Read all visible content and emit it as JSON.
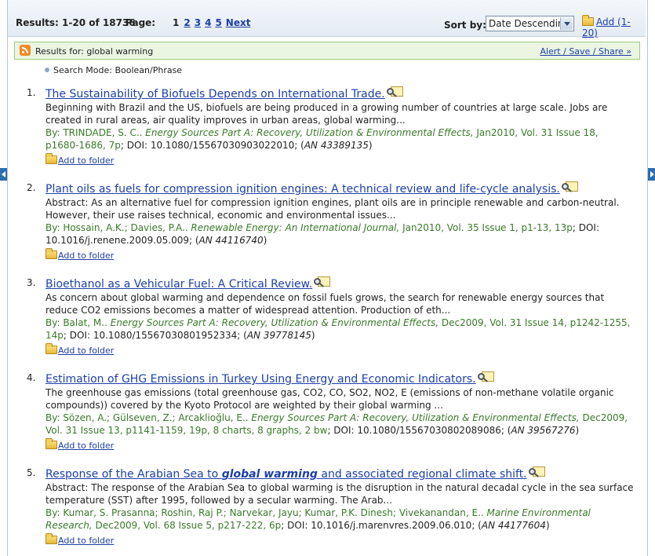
{
  "topbar": {
    "results_text": "Results: 1-20 of 18736",
    "page_label": "Page:",
    "current_page": "1",
    "pages": [
      "2",
      "3",
      "4",
      "5"
    ],
    "next_label": "Next",
    "sort_label": "Sort by:",
    "sort_value": "Date Descending",
    "add_label": "Add (1-20)"
  },
  "search_bar": {
    "results_for": "Results for:  global warming",
    "alert_link": "Alert / Save / Share »"
  },
  "search_mode": "Search Mode: Boolean/Phrase",
  "results": [
    {
      "num": "1.",
      "title": "The Sustainability of Biofuels Depends on International Trade.",
      "abstract": "Beginning with Brazil and the US, biofuels are being produced in a growing number of countries at large scale. Jobs are created in rural areas, air quality improves in urban areas, global warming...",
      "by": "By: TRINDADE, S. C.. ",
      "source": "Energy Sources Part A: Recovery, Utilization & Environmental Effects,",
      "details": " Jan2010, Vol. 31 Issue 18, p1680-1686, 7p",
      "doi": "; DOI: 10.1080/15567030903022010; (",
      "an": "AN 43389135",
      "close": ")",
      "folder": "Add to folder"
    },
    {
      "num": "2.",
      "title": "Plant oils as fuels for compression ignition engines: A technical review and life-cycle analysis.",
      "abstract": "Abstract: As an alternative fuel for compression ignition engines, plant oils are in principle renewable and carbon-neutral. However, their use raises technical, economic and environmental issues...",
      "by": "By: Hossain, A.K.; Davies, P.A.. ",
      "source": "Renewable Energy: An International Journal,",
      "details": " Jan2010, Vol. 35 Issue 1, p1-13, 13p",
      "doi": "; DOI: 10.1016/j.renene.2009.05.009; (",
      "an": "AN 44116740",
      "close": ")",
      "folder": "Add to folder"
    },
    {
      "num": "3.",
      "title": "Bioethanol as a Vehicular Fuel: A Critical Review.",
      "abstract": "As concern about global warming and dependence on fossil fuels grows, the search for renewable energy sources that reduce CO2 emissions becomes a matter of widespread attention. Production of eth...",
      "by": "By: Balat, M.. ",
      "source": "Energy Sources Part A: Recovery, Utilization & Environmental Effects,",
      "details": " Dec2009, Vol. 31 Issue 14, p1242-1255, 14p",
      "doi": "; DOI: 10.1080/15567030801952334; (",
      "an": "AN 39778145",
      "close": ")",
      "folder": "Add to folder"
    },
    {
      "num": "4.",
      "title": "Estimation of GHG Emissions in Turkey Using Energy and Economic Indicators.",
      "abstract": "The greenhouse gas emissions (total greenhouse gas, CO2, CO, SO2, NO2, E (emissions of non-methane volatile organic compounds)) covered by the Kyoto Protocol are weighted by their global warming ...",
      "by": "By: Sözen, A.; Gülseven, Z.; Arcaklioğlu, E.. ",
      "source": "Energy Sources Part A: Recovery, Utilization & Environmental Effects,",
      "details": " Dec2009, Vol. 31 Issue 13, p1141-1159, 19p, 8 charts, 8 graphs, 2 bw",
      "doi": "; DOI: 10.1080/15567030802089086; (",
      "an": "AN 39567276",
      "close": ")",
      "folder": "Add to folder"
    },
    {
      "num": "5.",
      "title_pre": "Response of the Arabian Sea to ",
      "title_em": "global warming",
      "title_post": " and associated regional climate shift.",
      "abstract": "Abstract: The response of the Arabian Sea to global warming is the disruption in the natural decadal cycle in the sea surface temperature (SST) after 1995, followed by a secular warming. The Arab...",
      "by": "By: Kumar, S. Prasanna; Roshin, Raj P.; Narvekar, Jayu; Kumar, P.K. Dinesh; Vivekanandan, E.. ",
      "source": "Marine Environmental Research,",
      "details": " Dec2009, Vol. 68 Issue 5, p217-222, 6p",
      "doi": "; DOI: 10.1016/j.marenvres.2009.06.010; (",
      "an": "AN 44177604",
      "close": ")",
      "folder": "Add to folder"
    }
  ]
}
